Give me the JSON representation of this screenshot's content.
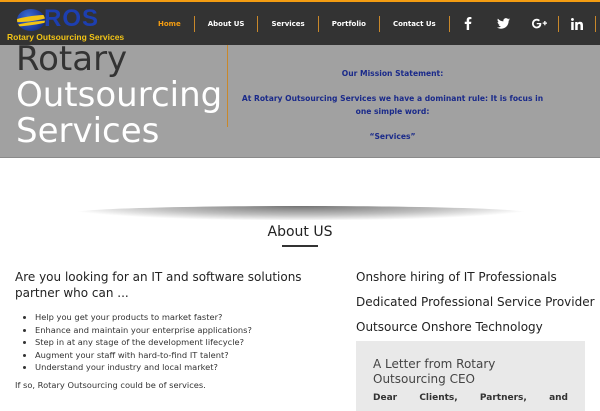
{
  "logo": {
    "letters": "ROS",
    "subtitle": "Rotary Outsourcing Services"
  },
  "nav": {
    "items": [
      {
        "label": "Home",
        "active": true
      },
      {
        "label": "About US",
        "active": false
      },
      {
        "label": "Services",
        "active": false
      },
      {
        "label": "Portfolio",
        "active": false
      },
      {
        "label": "Contact Us",
        "active": false
      }
    ],
    "social_icons": [
      "facebook-icon",
      "twitter-icon",
      "google-plus-icon",
      "linkedin-icon"
    ],
    "search_icon": "search-icon"
  },
  "hero": {
    "title_line1": "Rotary",
    "title_line2": "Outsourcing",
    "title_line3": "Services",
    "mission_heading": "Our Mission Statement:",
    "mission_text": "At Rotary Outsourcing Services we have a dominant rule: It is focus in one simple word:",
    "mission_word": "“Services”"
  },
  "about": {
    "heading": "About US",
    "lead": "Are you looking for an IT and software solutions partner who can ...",
    "bullets": [
      "Help you get your products to market faster?",
      "Enhance and maintain your enterprise applications?",
      "Step in at any stage of the development lifecycle?",
      "Augment your staff with hard-to-find IT talent?",
      "Understand your industry and local market?"
    ],
    "closing": "If so, Rotary Outsourcing could be of services."
  },
  "services": {
    "items": [
      "Onshore hiring of IT Professionals",
      "Dedicated Professional Service Provider",
      "Outsource Onshore Technology"
    ]
  },
  "letter": {
    "title": "A Letter from Rotary Outsourcing CEO",
    "body": "Dear Clients, Partners, and"
  },
  "colors": {
    "nav_bg": "#333333",
    "accent": "#f39c12",
    "hero_bg": "#a1a1a1",
    "mission_text": "#1a2a8a",
    "logo_blue": "#1d3fb0",
    "logo_gold": "#f2c416"
  }
}
